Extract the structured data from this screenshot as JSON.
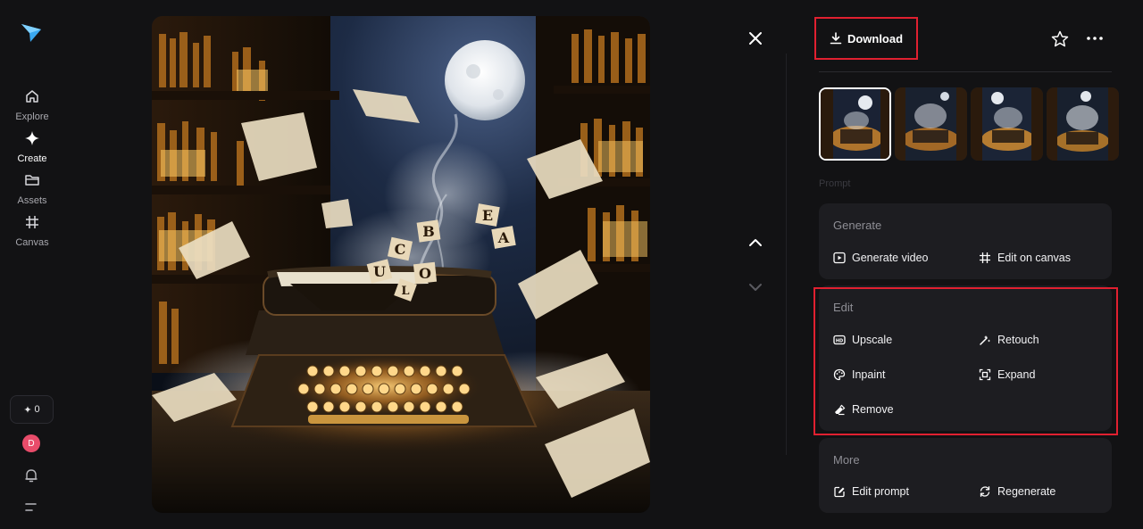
{
  "sidebar": {
    "items": [
      {
        "label": "Explore",
        "icon": "home-icon",
        "active": false
      },
      {
        "label": "Create",
        "icon": "sparkle-icon",
        "active": true
      },
      {
        "label": "Assets",
        "icon": "folder-icon",
        "active": false
      },
      {
        "label": "Canvas",
        "icon": "canvas-hash-icon",
        "active": false
      }
    ],
    "credits": "0",
    "avatar_initial": "D"
  },
  "image": {
    "letters": [
      "B",
      "E",
      "A",
      "C",
      "O",
      "U",
      "L"
    ]
  },
  "toolbar": {
    "download_label": "Download"
  },
  "prompt_label": "Prompt",
  "generate": {
    "title": "Generate",
    "actions": [
      {
        "label": "Generate video",
        "icon": "play-box-icon"
      },
      {
        "label": "Edit on canvas",
        "icon": "canvas-hash-icon"
      }
    ]
  },
  "edit": {
    "title": "Edit",
    "actions": [
      {
        "label": "Upscale",
        "icon": "hd-icon"
      },
      {
        "label": "Retouch",
        "icon": "magic-wand-icon"
      },
      {
        "label": "Inpaint",
        "icon": "palette-icon"
      },
      {
        "label": "Expand",
        "icon": "expand-icon"
      },
      {
        "label": "Remove",
        "icon": "eraser-icon"
      }
    ]
  },
  "more": {
    "title": "More",
    "actions": [
      {
        "label": "Edit prompt",
        "icon": "edit-prompt-icon"
      },
      {
        "label": "Regenerate",
        "icon": "regenerate-icon"
      }
    ]
  },
  "colors": {
    "background": "#121214",
    "card": "#1d1d21",
    "highlight": "#e02030",
    "brand": "#3aa8f0",
    "avatar": "#e84c6a"
  }
}
